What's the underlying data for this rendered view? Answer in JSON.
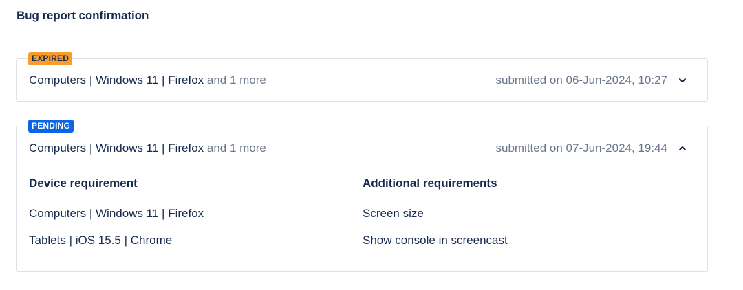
{
  "page": {
    "title": "Bug report confirmation"
  },
  "reports": [
    {
      "status": "EXPIRED",
      "status_color": "#f79d2f",
      "summary": "Computers | Windows 11 | Firefox",
      "more": "and 1 more",
      "submitted": "submitted on 06-Jun-2024, 10:27",
      "expanded": false
    },
    {
      "status": "PENDING",
      "status_color": "#0c66e4",
      "summary": "Computers | Windows 11 | Firefox",
      "more": "and 1 more",
      "submitted": "submitted on 07-Jun-2024, 19:44",
      "expanded": true,
      "device_heading": "Device requirement",
      "devices": [
        "Computers | Windows 11 | Firefox",
        "Tablets | iOS 15.5 | Chrome"
      ],
      "additional_heading": "Additional requirements",
      "additional": [
        "Screen size",
        "Show console in screencast"
      ]
    }
  ],
  "icons": {
    "collapsed": "chevron-down-icon",
    "expanded": "chevron-up-icon"
  }
}
